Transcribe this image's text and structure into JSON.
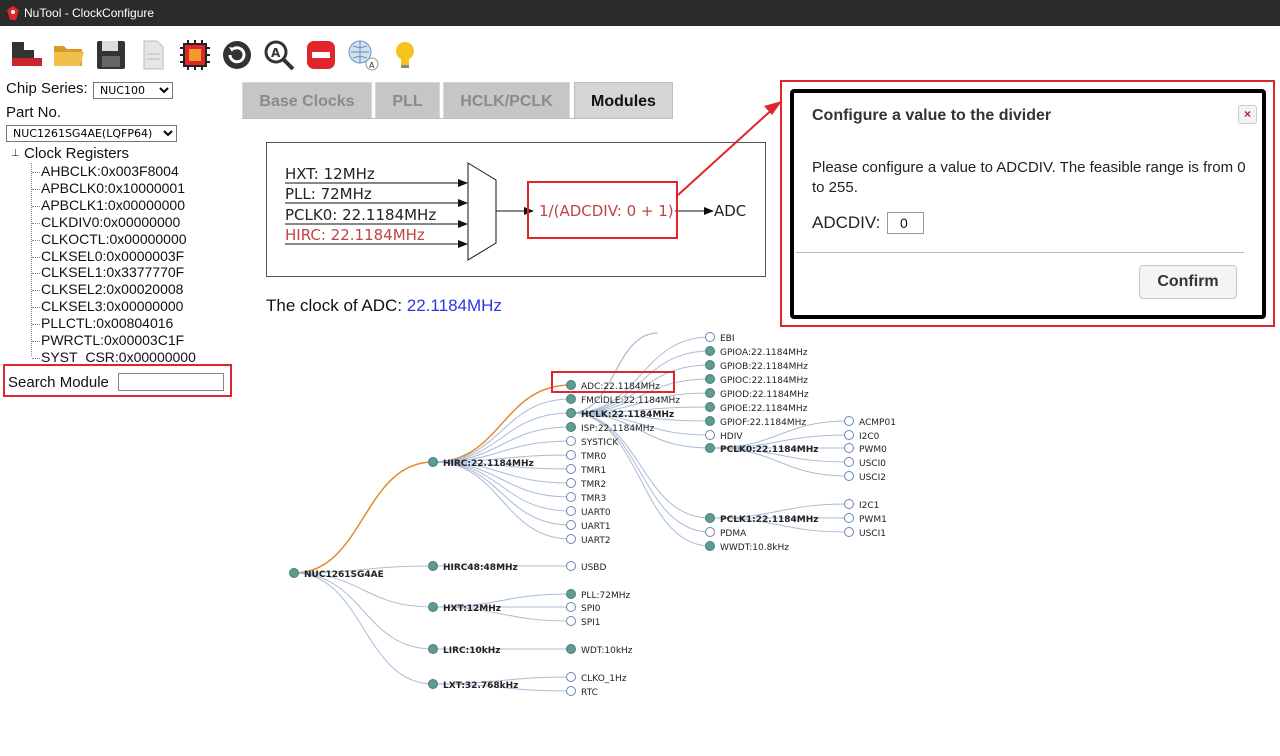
{
  "window": {
    "title": "NuTool - ClockConfigure"
  },
  "toolbar": {
    "icons": [
      "chip-stack-icon",
      "open-folder-icon",
      "save-disk-icon",
      "new-document-icon",
      "chip-icon",
      "reset-icon",
      "search-zoom-icon",
      "stop-icon",
      "globe-language-icon",
      "lightbulb-icon"
    ]
  },
  "left": {
    "chip_series_label": "Chip Series:",
    "chip_series_value": "NUC100",
    "part_no_label": "Part No.",
    "part_no_value": "NUC1261SG4AE(LQFP64)",
    "tree_root": "Clock Registers",
    "registers": [
      "AHBCLK:0x003F8004",
      "APBCLK0:0x10000001",
      "APBCLK1:0x00000000",
      "CLKDIV0:0x00000000",
      "CLKOCTL:0x00000000",
      "CLKSEL0:0x0000003F",
      "CLKSEL1:0x3377770F",
      "CLKSEL2:0x00020008",
      "CLKSEL3:0x00000000",
      "PLLCTL:0x00804016",
      "PWRCTL:0x00003C1F",
      "SYST_CSR:0x00000000"
    ],
    "search_label": "Search Module",
    "search_value": ""
  },
  "tabs": [
    "Base Clocks",
    "PLL",
    "HCLK/PCLK",
    "Modules"
  ],
  "active_tab": "Modules",
  "diagram": {
    "inputs": [
      "HXT: 12MHz",
      "PLL: 72MHz",
      "PCLK0: 22.1184MHz",
      "HIRC: 22.1184MHz"
    ],
    "divider": "1/(ADCDIV: 0 + 1)",
    "output": "ADC"
  },
  "clock_line": {
    "prefix": "The clock of ADC:",
    "value": "22.1184MHz"
  },
  "tree": {
    "root": "NUC1261SG4AE",
    "level1": [
      "HIRC:22.1184MHz",
      "HIRC48:48MHz",
      "HXT:12MHz",
      "LIRC:10kHz",
      "LXT:32.768kHz"
    ],
    "hirc_children": [
      "ADC:22.1184MHz",
      "FMCIDLE:22.1184MHz",
      "HCLK:22.1184MHz",
      "ISP:22.1184MHz",
      "SYSTICK",
      "TMR0",
      "TMR1",
      "TMR2",
      "TMR3",
      "UART0",
      "UART1",
      "UART2"
    ],
    "hirc48_children": [
      "USBD"
    ],
    "hxt_children": [
      "PLL:72MHz",
      "SPI0",
      "SPI1"
    ],
    "lirc_children": [
      "WDT:10kHz"
    ],
    "lxt_children": [
      "CLKO_1Hz",
      "RTC"
    ],
    "hclk_children": [
      "EBI",
      "GPIOA:22.1184MHz",
      "GPIOB:22.1184MHz",
      "GPIOC:22.1184MHz",
      "GPIOD:22.1184MHz",
      "GPIOE:22.1184MHz",
      "GPIOF:22.1184MHz",
      "HDIV",
      "PCLK0:22.1184MHz",
      "PCLK1:22.1184MHz",
      "PDMA",
      "WWDT:10.8kHz"
    ],
    "pclk0_children": [
      "ACMP01",
      "I2C0",
      "PWM0",
      "USCI0",
      "USCI2"
    ],
    "pclk1_children": [
      "I2C1",
      "PWM1",
      "USCI1"
    ]
  },
  "dialog": {
    "title": "Configure a value to the divider",
    "close": "×",
    "message": "Please configure a value to ADCDIV. The feasible range is from 0 to 255.",
    "field_label": "ADCDIV:",
    "field_value": "0",
    "confirm": "Confirm"
  },
  "colors": {
    "accent_red": "#e0262b",
    "path_orange": "#e8872a",
    "link_blue": "#a9bcd6",
    "value_blue": "#2a36e6",
    "node_fill": "#5f9b93"
  }
}
